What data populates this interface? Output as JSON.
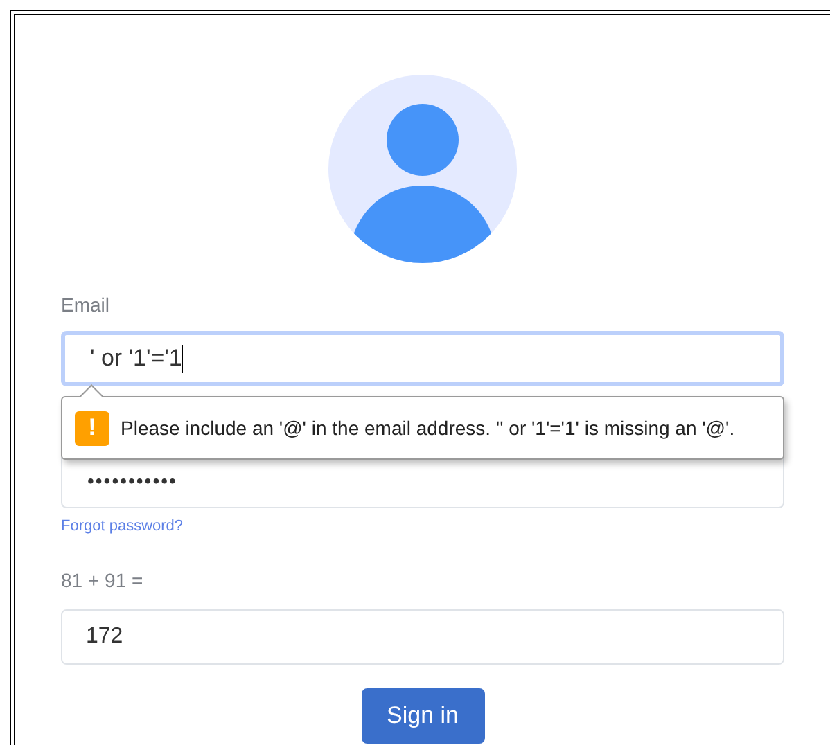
{
  "email": {
    "label": "Email",
    "value": "' or '1'='1",
    "focused": true
  },
  "validation_tooltip": {
    "message": "Please include an '@' in the email address. '' or '1'='1' is missing an '@'.",
    "icon": "!"
  },
  "password": {
    "value": "•••••••••••"
  },
  "forgot_password": "Forgot password?",
  "captcha": {
    "question": "81 + 91 =",
    "value": "172"
  },
  "sign_in_button": "Sign in"
}
